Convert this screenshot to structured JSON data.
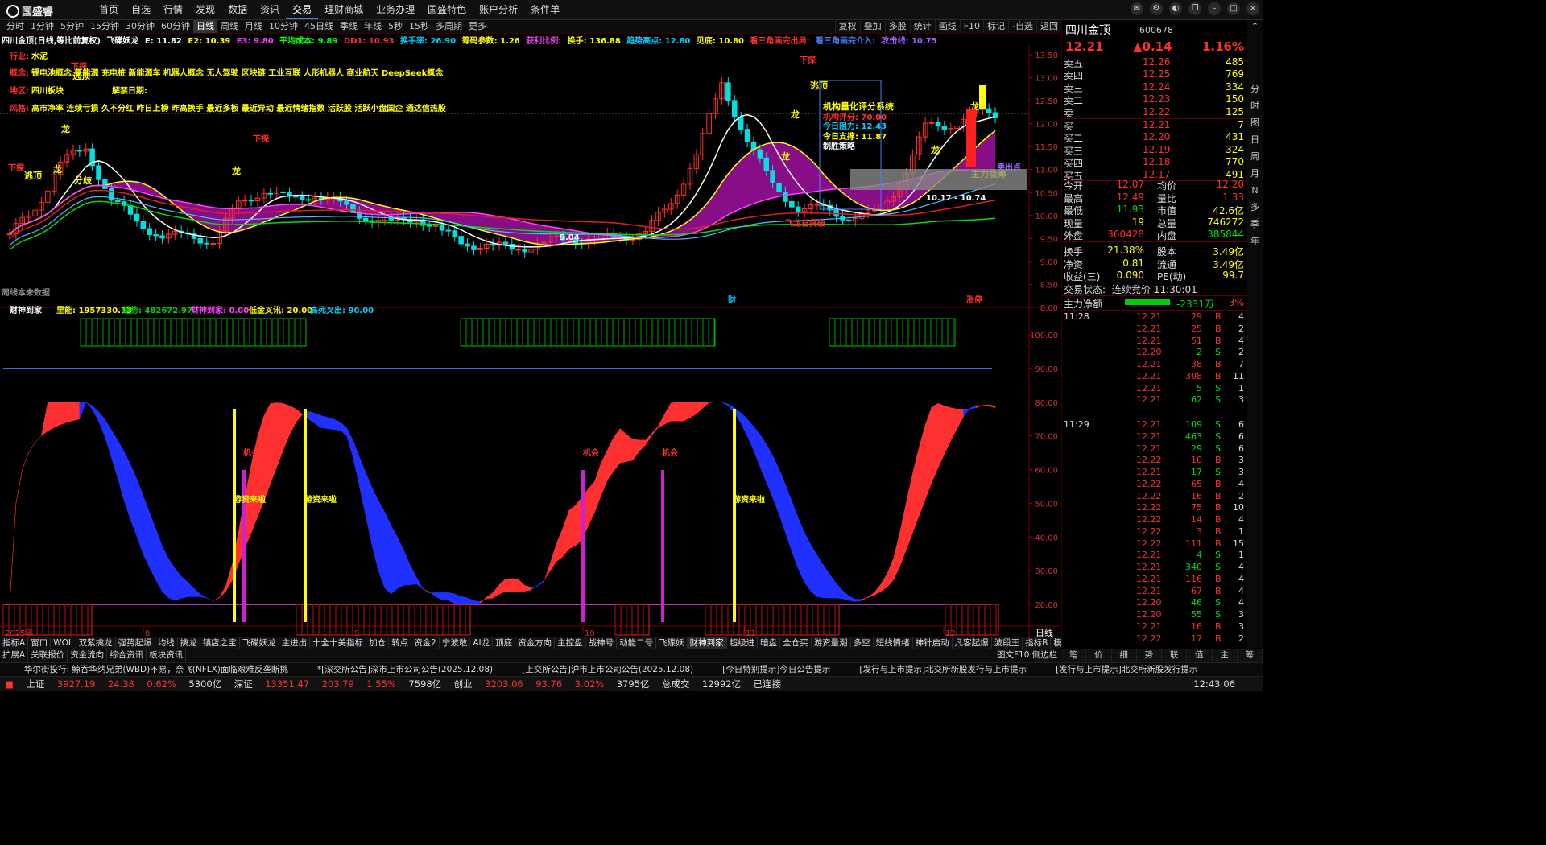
{
  "app": {
    "logo": "国盛睿"
  },
  "top_menu": [
    "首页",
    "自选",
    "行情",
    "发现",
    "数据",
    "资讯",
    "交易",
    "理财商城",
    "业务办理",
    "国盛特色",
    "账户分析",
    "条件单"
  ],
  "top_menu_active": 6,
  "periods": [
    "分时",
    "1分钟",
    "5分钟",
    "15分钟",
    "30分钟",
    "60分钟",
    "日线",
    "周线",
    "月线",
    "10分钟",
    "45日线",
    "季线",
    "年线",
    "5秒",
    "15秒",
    "多周期",
    "更多"
  ],
  "periods_selected": 6,
  "tools": [
    "复权",
    "叠加",
    "多股",
    "统计",
    "画线",
    "F10",
    "标记",
    "-自选",
    "返回"
  ],
  "main_header": {
    "name": "四川金顶(日线,等比前复权)",
    "indicator": "飞碟妖龙",
    "e1": "E: 11.82",
    "e2": "E2: 10.39",
    "e3": "E3: 9.80",
    "avg": "平均成本: 9.89",
    "dd": "DD1: 10.93",
    "turn": "换手率: 26.90",
    "chip": "筹码参数: 1.26",
    "profit": "获利比例:",
    "hand": "换手: 136.88",
    "trend": "趋势高点: 12.80",
    "low": "见底: 10.80",
    "tri1": "看三角画完出局:",
    "tri2": "看三角画完介入:",
    "atk": "攻击线: 10.75"
  },
  "info": {
    "industry_label": "行业:",
    "industry": "水泥",
    "concept_label": "概念:",
    "concept": "锂电池概念 氢能源 充电桩 新能源车 机器人概念 无人驾驶 区块链 工业互联 人形机器人 商业航天 DeepSeek概念",
    "region_label": "地区:",
    "region": "四川板块",
    "unban_label": "解禁日期:",
    "style_label": "风格:",
    "style": "高市净率 连续亏损 久不分红 昨日上榜 昨高换手 最近多板 最近异动 最近情绪指数 活跃股 活跃小盘国企 通达信热股"
  },
  "main_axis": [
    "13.50",
    "13.00",
    "12.50",
    "12.00",
    "11.50",
    "11.00",
    "10.50",
    "10.00",
    "9.50",
    "9.00",
    "8.50",
    "8.00"
  ],
  "chart_annotations": {
    "xiatan": "下探",
    "taoni": "逃顶",
    "long": "龙",
    "fenqi": "分歧",
    "jigou_title": "机构量化评分系统",
    "jigou_score": "机构评分: 70.00",
    "today_resist": "今日阻力: 12.43",
    "today_support": "今日支撑: 11.87",
    "strategy": "制胜策略",
    "zhuli": "主力吸筹",
    "sellpoint": "卖出点",
    "range": "10.17 - 10.74",
    "low_mark": "9.04",
    "caogao": "飞龙日突破",
    "footer_left": "周线本未数据",
    "cai": "财",
    "zhangting": "涨停"
  },
  "sub_header": {
    "name": "财神到家",
    "l1": "里能: 1957330.13",
    "l2": "趋势: 482672.97",
    "l3": "财神到家: 0.00",
    "l4": "低金叉讯: 20.00",
    "l5": "高死叉出: 90.00"
  },
  "sub_axis": [
    "100.00",
    "90.00",
    "80.00",
    "70.00",
    "60.00",
    "50.00",
    "40.00",
    "30.00",
    "20.00"
  ],
  "sub_labels": {
    "jihui": "机会",
    "youzi": "游资来啦"
  },
  "x_axis": {
    "yr": "2025年",
    "m8": "8",
    "m9": "9",
    "m10": "10",
    "m11": "11",
    "m12": "12",
    "period": "日线"
  },
  "chart_data": {
    "type": "candlestick",
    "series": [
      {
        "name": "四川金顶 日K",
        "close": [
          9.6,
          10.1,
          11.2,
          11.4,
          10.4,
          9.8,
          9.6,
          9.5,
          9.5,
          10.2,
          10.6,
          10.3,
          10.5,
          10.2,
          10.0,
          9.8,
          10.0,
          9.6,
          9.4,
          9.3,
          9.3,
          9.4,
          9.5,
          9.5,
          9.5,
          9.7,
          10.2,
          11.4,
          12.8,
          11.7,
          10.6,
          10.2,
          10.1,
          10.0,
          10.0,
          10.7,
          11.9,
          12.0,
          12.21
        ]
      }
    ],
    "ylim": [
      8.0,
      13.5
    ]
  },
  "quote": {
    "name": "四川金顶",
    "code": "600678",
    "price": "12.21",
    "change": "▲0.14",
    "pct": "1.16%",
    "asks": [
      [
        "卖五",
        "12.26",
        "485"
      ],
      [
        "卖四",
        "12.25",
        "769"
      ],
      [
        "卖三",
        "12.24",
        "334"
      ],
      [
        "卖二",
        "12.23",
        "150"
      ],
      [
        "卖一",
        "12.22",
        "125"
      ]
    ],
    "bids": [
      [
        "买一",
        "12.21",
        "7"
      ],
      [
        "买二",
        "12.20",
        "431"
      ],
      [
        "买三",
        "12.19",
        "324"
      ],
      [
        "买四",
        "12.18",
        "770"
      ],
      [
        "买五",
        "12.17",
        "491"
      ]
    ],
    "stats": [
      [
        "今开",
        "12.07",
        "均价",
        "12.20"
      ],
      [
        "最高",
        "12.49",
        "量比",
        "1.33"
      ],
      [
        "最低",
        "11.93",
        "市值",
        "42.6亿"
      ],
      [
        "现量",
        "19",
        "总量",
        "746272"
      ],
      [
        "外盘",
        "360428",
        "内盘",
        "385844"
      ],
      [
        "换手",
        "21.38%",
        "股本",
        "3.49亿"
      ],
      [
        "净资",
        "0.81",
        "流通",
        "3.49亿"
      ],
      [
        "收益(三)",
        "0.090",
        "PE(动)",
        "99.7"
      ]
    ],
    "state_label": "交易状态:",
    "state": "连续竞价 11:30:01",
    "netflow_label": "主力净额",
    "netflow": "-2331万",
    "netflow_pct": "-3%"
  },
  "ticks": [
    [
      "11:28",
      "12.21",
      "29",
      "B",
      "4"
    ],
    [
      "",
      "12.21",
      "25",
      "B",
      "2"
    ],
    [
      "",
      "12.21",
      "51",
      "B",
      "4"
    ],
    [
      "",
      "12.20",
      "2",
      "S",
      "2"
    ],
    [
      "",
      "12.21",
      "38",
      "B",
      "7"
    ],
    [
      "",
      "12.21",
      "308",
      "B",
      "11"
    ],
    [
      "",
      "12.21",
      "5",
      "S",
      "1"
    ],
    [
      "",
      "12.21",
      "62",
      "S",
      "3"
    ],
    [
      "11:29",
      "12.21",
      "109",
      "S",
      "6"
    ],
    [
      "",
      "12.21",
      "463",
      "S",
      "6"
    ],
    [
      "",
      "12.21",
      "29",
      "S",
      "6"
    ],
    [
      "",
      "12.22",
      "10",
      "B",
      "3"
    ],
    [
      "",
      "12.21",
      "17",
      "S",
      "3"
    ],
    [
      "",
      "12.22",
      "65",
      "B",
      "4"
    ],
    [
      "",
      "12.22",
      "16",
      "B",
      "2"
    ],
    [
      "",
      "12.22",
      "75",
      "B",
      "10"
    ],
    [
      "",
      "12.22",
      "14",
      "B",
      "4"
    ],
    [
      "",
      "12.22",
      "3",
      "B",
      "1"
    ],
    [
      "",
      "12.22",
      "111",
      "B",
      "15"
    ],
    [
      "",
      "12.21",
      "4",
      "S",
      "1"
    ],
    [
      "",
      "12.21",
      "340",
      "S",
      "4"
    ],
    [
      "",
      "12.21",
      "116",
      "B",
      "4"
    ],
    [
      "",
      "12.21",
      "67",
      "B",
      "4"
    ],
    [
      "",
      "12.20",
      "46",
      "S",
      "4"
    ],
    [
      "",
      "12.20",
      "55",
      "S",
      "3"
    ],
    [
      "",
      "12.21",
      "16",
      "B",
      "3"
    ],
    [
      "",
      "12.22",
      "17",
      "B",
      "2"
    ],
    [
      "11:30",
      "12.21",
      "19",
      "S",
      "4"
    ]
  ],
  "vtabs": [
    "分",
    "时",
    "图",
    "日",
    "周",
    "月",
    "N",
    "多",
    "季",
    "年"
  ],
  "ind_tabs": [
    "指标A",
    "窗口",
    "WOL",
    "双紫擒龙",
    "强势起爆",
    "均线",
    "擒龙",
    "镇店之宝",
    "飞碟妖龙",
    "主进出",
    "十全十美指标",
    "加仓",
    "转点",
    "资金2",
    "宁波敢",
    "AI龙",
    "顶底",
    "资金方向",
    "主控盘",
    "战神号",
    "动能二号",
    "飞碟妖",
    "财神到家",
    "超级进",
    "暗盘",
    "全仓买",
    "游资量潮",
    "多空",
    "短线情绪",
    "神针启动",
    "凡客起爆",
    "波段王",
    "指标B",
    "模板"
  ],
  "ind_selected": 22,
  "sub_tabs": [
    "扩展A",
    "关联报价",
    "资金流向",
    "综合资讯",
    "板块资讯"
  ],
  "rp_tabs": [
    "笔",
    "价",
    "细",
    "势",
    "联",
    "值",
    "主",
    "筹"
  ],
  "rp_footer": "图文F10",
  "rp_footer2": "侧边栏",
  "news": [
    "华尔街投行: 鲸吞华纳兄弟(WBD)不易，奈飞(NFLX)面临艰难反垄断挑",
    "*[深交所公告]深市上市公司公告(2025.12.08)",
    "[上交所公告]沪市上市公司公告(2025.12.08)",
    "[今日特别提示]今日公告提示",
    "[发行与上市提示]北交所新股发行与上市提示",
    "[发行与上市提示]北交所新股发行提示"
  ],
  "status": {
    "sh": "上证",
    "sh_v": "3927.19",
    "sh_c": "24.38",
    "sh_p": "0.62%",
    "sh_a": "5300亿",
    "sz": "深证",
    "sz_v": "13351.47",
    "sz_c": "203.79",
    "sz_p": "1.55%",
    "sz_a": "7598亿",
    "cy": "创业",
    "cy_v": "3203.06",
    "cy_c": "93.76",
    "cy_p": "3.02%",
    "cy_a": "3795亿",
    "total": "总成交",
    "total_v": "12992亿",
    "conn": "已连接",
    "time": "12:43:06"
  }
}
